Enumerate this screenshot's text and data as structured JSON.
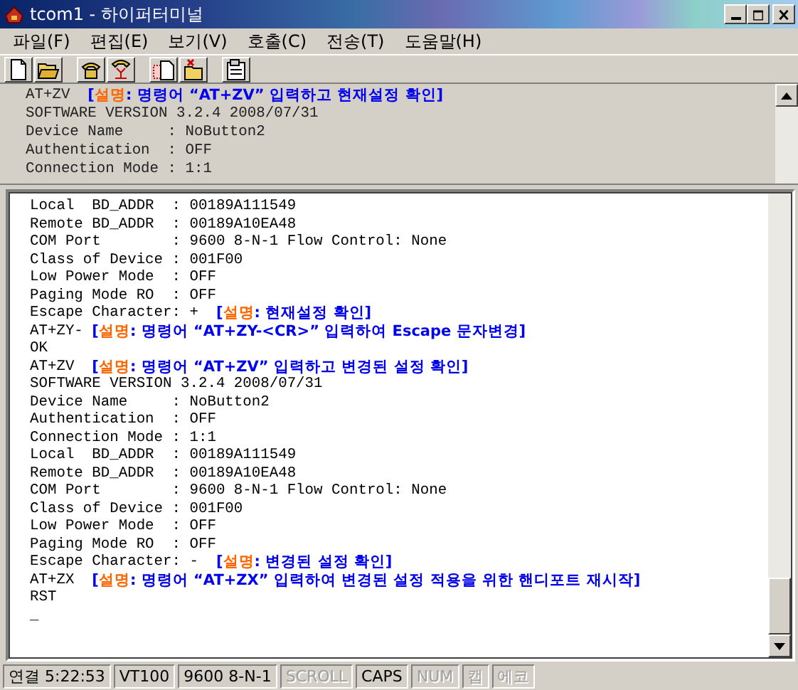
{
  "window": {
    "title": "tcom1 - 하이퍼터미널"
  },
  "menu": [
    {
      "label": "파일(F)"
    },
    {
      "label": "편집(E)"
    },
    {
      "label": "보기(V)"
    },
    {
      "label": "호출(C)"
    },
    {
      "label": "전송(T)"
    },
    {
      "label": "도움말(H)"
    }
  ],
  "toolbar": [
    {
      "kind": "new"
    },
    {
      "kind": "open"
    },
    {
      "kind": "sep"
    },
    {
      "kind": "call"
    },
    {
      "kind": "hangup"
    },
    {
      "kind": "sep"
    },
    {
      "kind": "send"
    },
    {
      "kind": "receive"
    },
    {
      "kind": "sep"
    },
    {
      "kind": "properties"
    }
  ],
  "scrollback": {
    "lines": [
      {
        "text": "AT+ZV  ",
        "note": {
          "open": "[",
          "label": "설명",
          "body": ": 명령어 “AT+ZV” 입력하고 현재설정 확인]"
        }
      },
      {
        "text": "SOFTWARE VERSION 3.2.4 2008/07/31"
      },
      {
        "text": "Device Name     : NoButton2"
      },
      {
        "text": "Authentication  : OFF"
      },
      {
        "text": "Connection Mode : 1:1"
      }
    ]
  },
  "terminal": {
    "lines": [
      {
        "text": "Local  BD_ADDR  : 00189A111549"
      },
      {
        "text": "Remote BD_ADDR  : 00189A10EA48"
      },
      {
        "text": "COM Port        : 9600 8-N-1 Flow Control: None"
      },
      {
        "text": "Class of Device : 001F00"
      },
      {
        "text": "Low Power Mode  : OFF"
      },
      {
        "text": "Paging Mode RO  : OFF"
      },
      {
        "text": "Escape Character: +  ",
        "note": {
          "open": "[",
          "label": "설명",
          "body": ": 현재설정 확인]"
        }
      },
      {
        "text": "AT+ZY- ",
        "note": {
          "open": "[",
          "label": "설명",
          "body": ": 명령어 “AT+ZY-<CR>” 입력하여 Escape 문자변경]"
        }
      },
      {
        "text": "OK"
      },
      {
        "text": "AT+ZV  ",
        "note": {
          "open": "[",
          "label": "설명",
          "body": ": 명령어 “AT+ZV” 입력하고 변경된 설정 확인]"
        }
      },
      {
        "text": "SOFTWARE VERSION 3.2.4 2008/07/31"
      },
      {
        "text": "Device Name     : NoButton2"
      },
      {
        "text": "Authentication  : OFF"
      },
      {
        "text": "Connection Mode : 1:1"
      },
      {
        "text": "Local  BD_ADDR  : 00189A111549"
      },
      {
        "text": "Remote BD_ADDR  : 00189A10EA48"
      },
      {
        "text": "COM Port        : 9600 8-N-1 Flow Control: None"
      },
      {
        "text": "Class of Device : 001F00"
      },
      {
        "text": "Low Power Mode  : OFF"
      },
      {
        "text": "Paging Mode RO  : OFF"
      },
      {
        "text": "Escape Character: -  ",
        "note": {
          "open": "[",
          "label": "설명",
          "body": ": 변경된 설정 확인]"
        }
      },
      {
        "text": "AT+ZX  ",
        "note": {
          "open": "[",
          "label": "설명",
          "body": ": 명령어 “AT+ZX” 입력하여 변경된 설정 적용을 위한 핸디포트 재시작]"
        }
      },
      {
        "text": "RST"
      },
      {
        "text": "_"
      }
    ]
  },
  "status_bar": [
    {
      "label": "연결 5:22:53",
      "disabled": false
    },
    {
      "label": "VT100",
      "disabled": false
    },
    {
      "label": "9600 8-N-1",
      "disabled": false
    },
    {
      "label": "SCROLL",
      "disabled": true
    },
    {
      "label": "CAPS",
      "disabled": false
    },
    {
      "label": "NUM",
      "disabled": true
    },
    {
      "label": "캡",
      "disabled": true
    },
    {
      "label": "에코",
      "disabled": true
    }
  ]
}
